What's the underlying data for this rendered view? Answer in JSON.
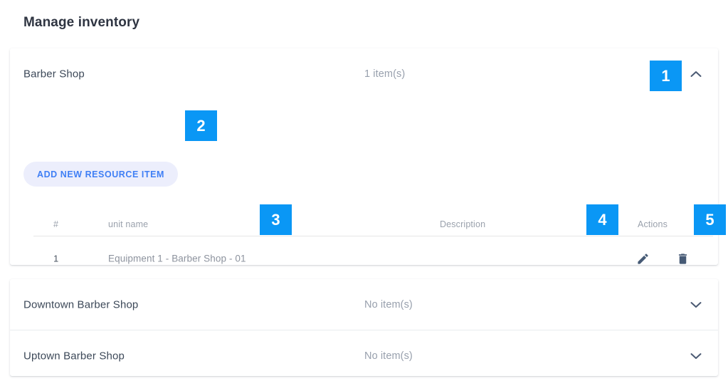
{
  "page": {
    "title": "Manage inventory"
  },
  "groups": [
    {
      "name": "Barber Shop",
      "count_label": "1 item(s)",
      "expanded": true,
      "toggle_icon": "chevron-up-icon",
      "add_button_label": "ADD NEW RESOURCE ITEM",
      "table": {
        "headers": {
          "number": "#",
          "unit_name": "unit name",
          "description": "Description",
          "actions": "Actions"
        },
        "rows": [
          {
            "number": "1",
            "unit_name": "Equipment 1 - Barber Shop - 01",
            "description": "",
            "edit_icon": "pencil-icon",
            "delete_icon": "trash-icon"
          }
        ]
      }
    },
    {
      "name": "Downtown Barber Shop",
      "count_label": "No item(s)",
      "expanded": false,
      "toggle_icon": "chevron-down-icon"
    },
    {
      "name": "Uptown Barber Shop",
      "count_label": "No item(s)",
      "expanded": false,
      "toggle_icon": "chevron-down-icon"
    }
  ],
  "annotations": {
    "badges": [
      {
        "label": "1"
      },
      {
        "label": "2"
      },
      {
        "label": "3"
      },
      {
        "label": "4"
      },
      {
        "label": "5"
      }
    ],
    "color": "#0a97f5"
  },
  "colors": {
    "accent": "#3f7ff5",
    "badge": "#0a97f5",
    "text_primary": "#3c4858",
    "text_muted": "#98a0ad",
    "button_background": "#eceefc",
    "icon": "#4b5a73"
  }
}
